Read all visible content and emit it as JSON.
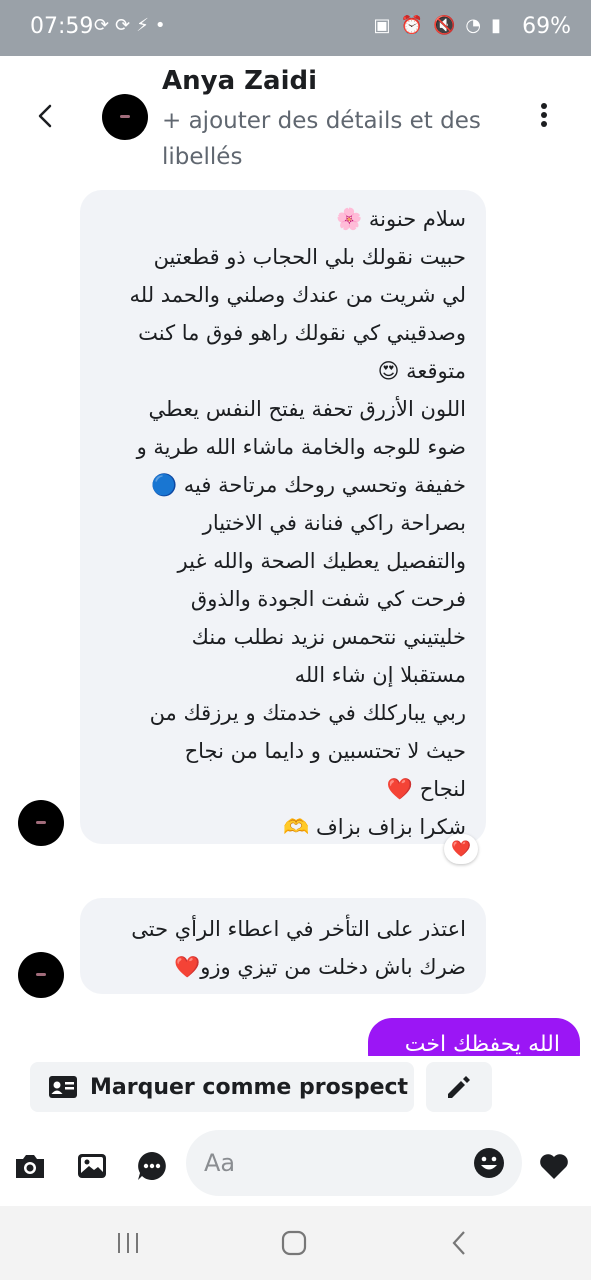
{
  "status_bar": {
    "time": "07:59",
    "battery": "69%",
    "left_icons": [
      "sync-icon",
      "sync-icon",
      "messenger-icon",
      "dot-icon"
    ],
    "right_icons": [
      "sim-icon",
      "alarm-icon",
      "mute-icon",
      "wifi-icon",
      "signal-icon"
    ]
  },
  "header": {
    "contact_name": "Anya Zaidi",
    "subtitle": "+ ajouter des détails et des libellés"
  },
  "messages": [
    {
      "direction": "incoming",
      "lines": [
        "سلام حنونة 🌸",
        "حبيت نقولك بلي الحجاب ذو قطعتين",
        "لي شريت من عندك وصلني والحمد لله",
        "وصدقيني كي نقولك راهو فوق ما كنت",
        "متوقعة 😍",
        "اللون الأزرق تحفة يفتح النفس يعطي",
        "ضوء للوجه والخامة ماشاء الله طرية و",
        "خفيفة وتحسي روحك مرتاحة فيه 🔵",
        "بصراحة راكي فنانة في الاختيار",
        "والتفصيل يعطيك الصحة والله غير",
        "فرحت كي شفت الجودة والذوق",
        "خليتيني نتحمس نزيد نطلب منك",
        "مستقبلا إن شاء الله",
        "ربي يباركلك في خدمتك و يرزقك من",
        "حيث لا تحتسبين و دايما من نجاح",
        "لنجاح ❤️",
        "شكرا بزاف بزاف 🫶"
      ],
      "reaction": "❤️"
    },
    {
      "direction": "incoming",
      "lines": [
        "اعتذر على التأخر في اعطاء الرأي حتى",
        "ضرك باش دخلت من تيزي وزو❤️"
      ]
    },
    {
      "direction": "outgoing",
      "text": "الله يحفظك اخت"
    }
  ],
  "actions": {
    "prospect_label": "Marquer comme prospect"
  },
  "composer": {
    "placeholder": "Aa"
  },
  "colors": {
    "outgoing_bubble": "#9b16f5",
    "incoming_bubble": "#f1f3f7",
    "status_bar": "#9aa1a8"
  }
}
